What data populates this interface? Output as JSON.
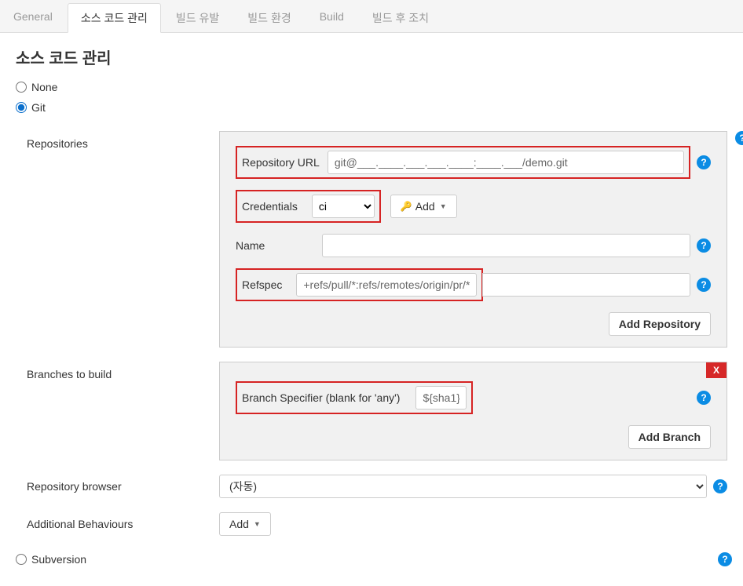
{
  "tabs": [
    "General",
    "소스 코드 관리",
    "빌드 유발",
    "빌드 환경",
    "Build",
    "빌드 후 조치"
  ],
  "active_tab_index": 1,
  "section_title": "소스 코드 관리",
  "scm": {
    "options": [
      "None",
      "Git",
      "Subversion"
    ],
    "selected": "Git"
  },
  "repositories": {
    "section_label": "Repositories",
    "url_label": "Repository URL",
    "url_value": "git@___.____.___.___.____:____.___/demo.git",
    "credentials_label": "Credentials",
    "credentials_value": "ci",
    "credentials_add_btn": "Add",
    "name_label": "Name",
    "name_value": "",
    "refspec_label": "Refspec",
    "refspec_value": "+refs/pull/*:refs/remotes/origin/pr/*",
    "add_repo_btn": "Add Repository"
  },
  "branches": {
    "section_label": "Branches to build",
    "specifier_label": "Branch Specifier (blank for 'any')",
    "specifier_value": "${sha1}",
    "add_branch_btn": "Add Branch"
  },
  "repo_browser": {
    "section_label": "Repository browser",
    "value": "(자동)"
  },
  "additional_behaviours": {
    "section_label": "Additional Behaviours",
    "add_btn": "Add"
  },
  "help_glyph": "?"
}
